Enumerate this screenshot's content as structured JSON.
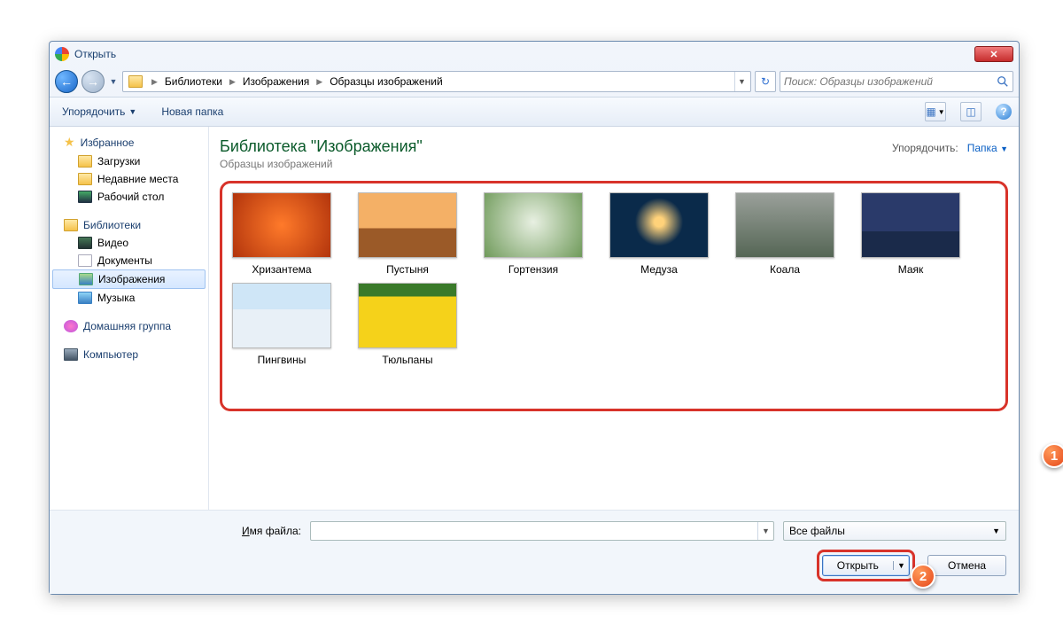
{
  "title": "Открыть",
  "breadcrumb": {
    "root": "Библиотеки",
    "mid": "Изображения",
    "leaf": "Образцы изображений"
  },
  "search": {
    "placeholder": "Поиск: Образцы изображений"
  },
  "toolbar": {
    "organize": "Упорядочить",
    "newfolder": "Новая папка"
  },
  "sidebar": {
    "favorites": {
      "label": "Избранное",
      "items": [
        "Загрузки",
        "Недавние места",
        "Рабочий стол"
      ]
    },
    "libraries": {
      "label": "Библиотеки",
      "items": [
        "Видео",
        "Документы",
        "Изображения",
        "Музыка"
      ]
    },
    "homegroup": "Домашняя группа",
    "computer": "Компьютер"
  },
  "library": {
    "title": "Библиотека \"Изображения\"",
    "subtitle": "Образцы изображений",
    "sort_label": "Упорядочить:",
    "sort_value": "Папка"
  },
  "items": [
    {
      "name": "Хризантема",
      "cls": "g-chrys"
    },
    {
      "name": "Пустыня",
      "cls": "g-desert"
    },
    {
      "name": "Гортензия",
      "cls": "g-hyd"
    },
    {
      "name": "Медуза",
      "cls": "g-jelly"
    },
    {
      "name": "Коала",
      "cls": "g-koala"
    },
    {
      "name": "Маяк",
      "cls": "g-light"
    },
    {
      "name": "Пингвины",
      "cls": "g-peng"
    },
    {
      "name": "Тюльпаны",
      "cls": "g-tulip"
    }
  ],
  "footer": {
    "filename_label_prefix": "И",
    "filename_label_rest": "мя файла:",
    "filename_value": "",
    "filetype": "Все файлы",
    "open": "Открыть",
    "cancel": "Отмена"
  },
  "callouts": {
    "one": "1",
    "two": "2"
  }
}
